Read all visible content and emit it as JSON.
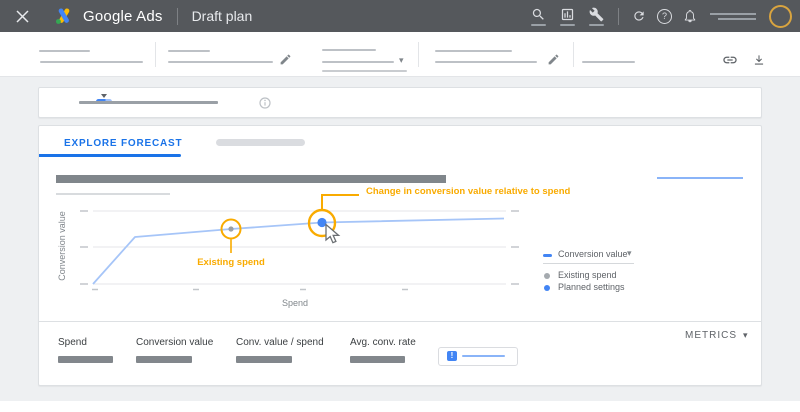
{
  "topbar": {
    "brand": "Google Ads",
    "page_title": "Draft plan"
  },
  "tabs": {
    "explore_forecast": "EXPLORE FORECAST"
  },
  "chart": {
    "y_axis_label": "Conversion value",
    "x_axis_label": "Spend",
    "annotations": {
      "existing_spend": "Existing spend",
      "change_in_value": "Change in conversion value relative to spend"
    },
    "legend": {
      "series_selector": "Conversion value",
      "existing_spend": "Existing spend",
      "planned_settings": "Planned settings"
    }
  },
  "chart_data": {
    "type": "line",
    "title": "",
    "xlabel": "Spend",
    "ylabel": "Conversion value",
    "axis_values_labeled": false,
    "grid": true,
    "legend_position": "right",
    "series": [
      {
        "name": "Conversion value",
        "points_normalized": [
          [
            0.0,
            0.0
          ],
          [
            0.1,
            0.64
          ],
          [
            0.33,
            0.75
          ],
          [
            0.55,
            0.84
          ],
          [
            1.0,
            0.9
          ]
        ]
      }
    ],
    "markers": [
      {
        "label": "Existing spend",
        "x": 0.33,
        "y": 0.75,
        "color": "#9AA0A6"
      },
      {
        "label": "Planned settings",
        "x": 0.55,
        "y": 0.84,
        "color": "#4285F4"
      }
    ]
  },
  "metrics": {
    "button_label": "METRICS",
    "items": [
      {
        "label": "Spend"
      },
      {
        "label": "Conversion value"
      },
      {
        "label": "Conv. value / spend"
      },
      {
        "label": "Avg. conv. rate"
      }
    ]
  },
  "icons": {
    "caret_down": "▾",
    "question_mark": "?",
    "alert": "!"
  },
  "colors": {
    "accent_blue": "#4285F4",
    "tab_blue": "#1A73E8",
    "line_blue": "#A6C5F8",
    "annotation_yellow": "#F9AB00",
    "avatar_ring": "#D9A43F",
    "topbar_bg": "#55585C"
  }
}
